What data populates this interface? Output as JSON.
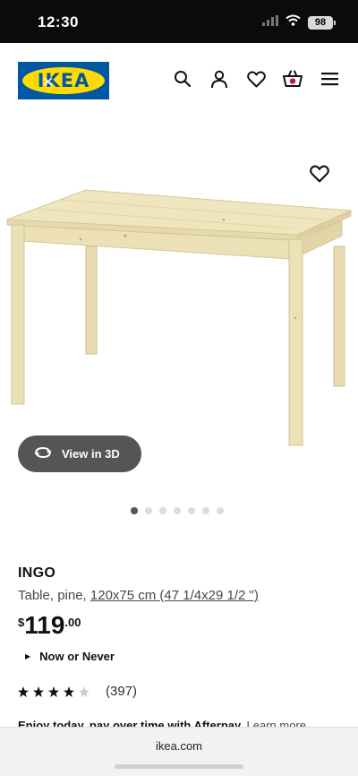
{
  "status_bar": {
    "time": "12:30",
    "battery": "98"
  },
  "header": {
    "logo_text": "IKEA",
    "close_glyph": "✕",
    "icons": [
      "search-icon",
      "profile-icon",
      "heart-icon",
      "shopping-bag-icon",
      "menu-icon"
    ]
  },
  "product_image": {
    "view_3d_label": "View in 3D",
    "dots_total": 7,
    "active_dot": 0
  },
  "product": {
    "name": "INGO",
    "description_prefix": "Table, pine, ",
    "dimensions": "120x75 cm (47 1/4x29 1/2 \")",
    "price_currency": "$",
    "price_whole": "119",
    "price_cents": ".00",
    "tag": "Now or Never",
    "rating": 4.5,
    "rating_count": "(397)",
    "afterpay_text": "Enjoy today, pay over time with Afterpay.",
    "afterpay_link": "Learn more"
  },
  "browser": {
    "url": "ikea.com"
  },
  "colors": {
    "ikea_blue": "#0058a3",
    "ikea_yellow": "#ffdb00",
    "button_dark": "#555555"
  }
}
